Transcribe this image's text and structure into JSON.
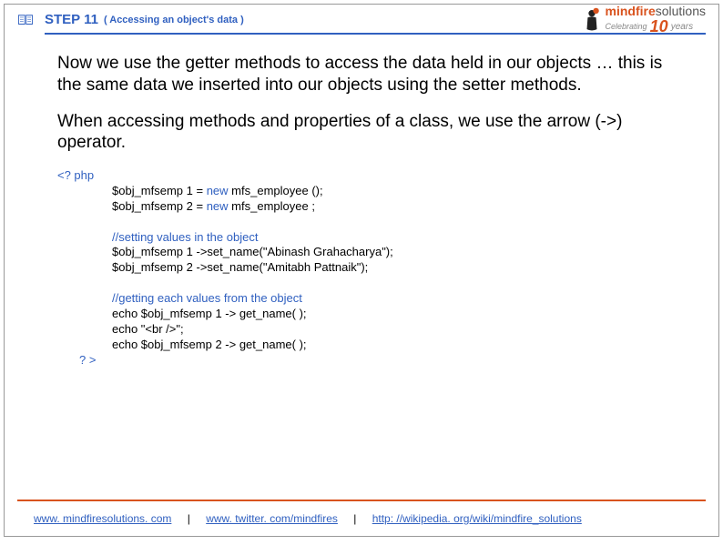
{
  "header": {
    "step": "STEP 11",
    "subtitle": "( Accessing an object's data  )"
  },
  "logo": {
    "brand": "mindfire",
    "suffix": "solutions",
    "celebrating": "Celebrating",
    "ten": "10",
    "years": "years"
  },
  "para1": "Now we use the getter methods to access the data held in our objects … this is the same data we inserted into our objects using the setter methods.",
  "para2": "When accessing methods and properties of a class, we use the arrow  (->) operator.",
  "code": {
    "open": "<? php",
    "l1a": "$obj_mfsemp 1 = ",
    "l1kw": "new",
    "l1b": " mfs_employee ();",
    "l2a": "$obj_mfsemp 2 = ",
    "l2kw": "new",
    "l2b": " mfs_employee ;",
    "c1": "//setting values in the object",
    "l3": "$obj_mfsemp 1 ->set_name(\"Abinash Grahacharya\");",
    "l4": "$obj_mfsemp 2 ->set_name(\"Amitabh Pattnaik\");",
    "c2": "//getting each values from the object",
    "l5": "echo $obj_mfsemp 1 -> get_name( );",
    "l6": "echo \"<br />\";",
    "l7": "echo $obj_mfsemp 2 -> get_name( );",
    "close": "? >"
  },
  "footer": {
    "link1": "www. mindfiresolutions. com",
    "link2": "www. twitter. com/mindfires",
    "link3": "http: //wikipedia. org/wiki/mindfire_solutions",
    "sep": "|"
  }
}
